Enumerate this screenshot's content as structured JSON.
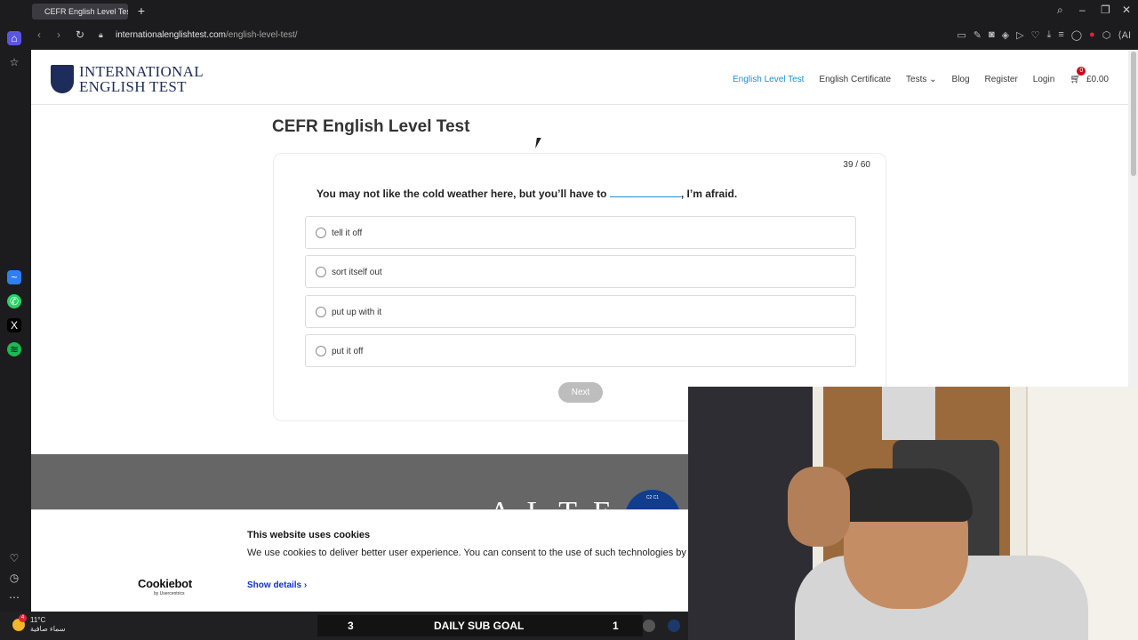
{
  "browser": {
    "tab_title": "CEFR English Level Test - I",
    "url_host": "internationalenglishtest.com",
    "url_path": "/english-level-test/"
  },
  "site": {
    "logo_line1": "INTERNATIONAL",
    "logo_line2": "ENGLISH TEST",
    "nav": [
      "English Level Test",
      "English Certificate",
      "Tests",
      "Blog",
      "Register",
      "Login"
    ],
    "cart_count": "0",
    "cart_total": "£0.00"
  },
  "test": {
    "title": "CEFR English Level Test",
    "progress": "39 / 60",
    "question_before": "You may not like the cold weather here, but you’ll have to",
    "question_after": ", I’m afraid.",
    "options": [
      "tell it off",
      "sort itself out",
      "put up with it",
      "put it off"
    ],
    "next_label": "Next"
  },
  "footer": {
    "alte_text": "ALTE",
    "badge_text": "C2 C1"
  },
  "cookie": {
    "title": "This website uses cookies",
    "text": "We use cookies to deliver better user experience. You can consent to the use of such technologies by ac",
    "brand": "Cookiebot",
    "brand_sub": "by Usercentrics",
    "show_details": "Show details"
  },
  "taskbar": {
    "temp": "11°C",
    "weather_desc": "سماء صافية",
    "sub_goal_left": "3",
    "sub_goal_label": "DAILY SUB GOAL",
    "sub_goal_right": "1",
    "weather_badge": "4"
  },
  "colors": {
    "accent": "#1d8fd6",
    "brand_navy": "#1d2c5a",
    "next_disabled": "#bdbdbd",
    "cookie_link": "#1032cf"
  }
}
